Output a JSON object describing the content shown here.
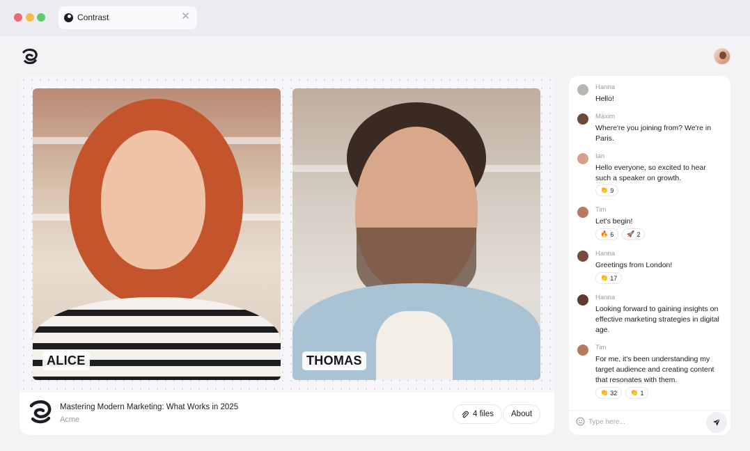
{
  "browser": {
    "tab_title": "Contrast",
    "tab_close": "✕"
  },
  "videos": [
    {
      "name": "ALICE"
    },
    {
      "name": "THOMAS"
    }
  ],
  "meeting": {
    "title": "Mastering Modern Marketing: What Works in 2025",
    "organization": "Acme",
    "files_label": "4 files",
    "about_label": "About"
  },
  "chat": {
    "messages": [
      {
        "author": "Hanna",
        "text": "Hello!",
        "avatar_color": "#b9b6b2"
      },
      {
        "author": "Maxim",
        "text": "Where're you joining from? We're in Paris.",
        "avatar_color": "#6e4a3a"
      },
      {
        "author": "Ian",
        "text": "Hello everyone, so excited to hear such a speaker on growth.",
        "avatar_color": "#d8a08a",
        "reactions": [
          {
            "emoji": "👏",
            "count": "9"
          }
        ]
      },
      {
        "author": "Tim",
        "text": "Let's begin!",
        "avatar_color": "#b87a5e",
        "reactions": [
          {
            "emoji": "🔥",
            "count": "6"
          },
          {
            "emoji": "🚀",
            "count": "2"
          }
        ]
      },
      {
        "author": "Hanna",
        "text": "Greetings from London!",
        "avatar_color": "#7a4a38",
        "reactions": [
          {
            "emoji": "👏",
            "count": "17"
          }
        ]
      },
      {
        "author": "Hanna",
        "text": "Looking forward to gaining insights on effective marketing strategies in digital age.",
        "avatar_color": "#5e3a2c"
      },
      {
        "author": "Tim",
        "text": "For me, it's been understanding my target audience and creating content that resonates with them.",
        "avatar_color": "#b87a5e",
        "reactions": [
          {
            "emoji": "👏",
            "count": "32"
          },
          {
            "emoji": "👏",
            "count": "1"
          }
        ]
      }
    ],
    "input_placeholder": "Type here..."
  },
  "colors": {
    "background": "#f3f3f6",
    "panel": "#ffffff",
    "text": "#1c1c22",
    "muted": "#9a9aa4"
  }
}
